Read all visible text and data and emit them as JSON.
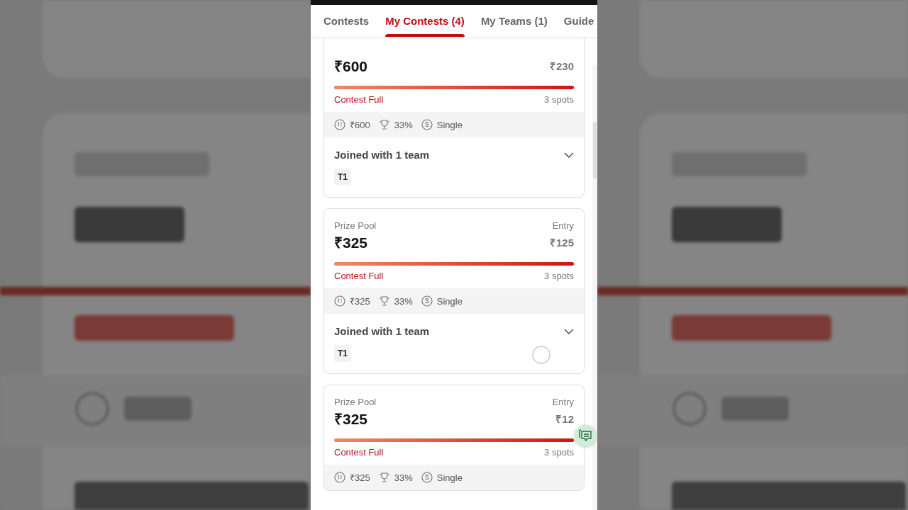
{
  "tabs": [
    {
      "label": "Contests",
      "selected": false
    },
    {
      "label": "My Contests (4)",
      "selected": true
    },
    {
      "label": "My Teams (1)",
      "selected": false
    },
    {
      "label": "Guide",
      "selected": false
    }
  ],
  "contests": [
    {
      "prize": "₹600",
      "entry": "₹230",
      "level": 1,
      "status": "Contest Full",
      "spots": "3 spots",
      "first_prize": "₹600",
      "win_percent": "33%",
      "entry_type": "Single",
      "joined": "Joined with 1 team",
      "teams": [
        "T1"
      ]
    },
    {
      "prize_label": "Prize Pool",
      "entry_label": "Entry",
      "prize": "₹325",
      "entry": "₹125",
      "level": 1,
      "status": "Contest Full",
      "spots": "3 spots",
      "first_prize": "₹325",
      "win_percent": "33%",
      "entry_type": "Single",
      "joined": "Joined with 1 team",
      "teams": [
        "T1"
      ]
    },
    {
      "prize_label": "Prize Pool",
      "entry_label": "Entry",
      "prize": "₹325",
      "entry": "₹12",
      "level": 1,
      "status": "Contest Full",
      "spots": "3 spots",
      "first_prize": "₹325",
      "win_percent": "33%",
      "entry_type": "Single"
    }
  ]
}
